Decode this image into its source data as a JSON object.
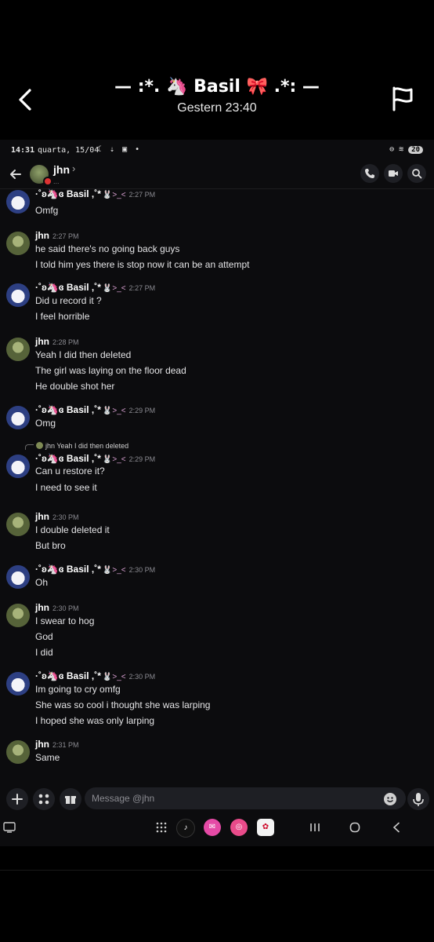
{
  "viewer": {
    "title": "— :*. 🦄 Basil 🎀 .*: —",
    "subtitle": "Gestern 23:40"
  },
  "status_bar": {
    "time": "14:31",
    "date": "quarta, 15/04",
    "battery": "20"
  },
  "chat_header": {
    "name": "jhn",
    "chevron": "›",
    "subtitle": "..."
  },
  "name_deco": "🐰>_<",
  "messages": [
    {
      "author": "·˚ʚ🦄ɞ Basil ,˚*",
      "time": "2:27 PM",
      "lines": [
        "Omfg"
      ]
    },
    {
      "author": "jhn",
      "time": "2:27 PM",
      "lines": [
        "he said there's no going back guys",
        "I told him yes there is stop now it can be an attempt"
      ]
    },
    {
      "author": "·˚ʚ🦄ɞ Basil ,˚*",
      "time": "2:27 PM",
      "lines": [
        "Did u record it ?",
        "I feel horrible"
      ]
    },
    {
      "author": "jhn",
      "time": "2:28 PM",
      "lines": [
        "Yeah I did then deleted",
        "The girl was laying on the floor dead",
        "He double shot her"
      ]
    },
    {
      "author": "·˚ʚ🦄ɞ Basil ,˚*",
      "time": "2:29 PM",
      "lines": [
        "Omg"
      ]
    },
    {
      "author": "·˚ʚ🦄ɞ Basil ,˚*",
      "time": "2:29 PM",
      "reply": {
        "name": "jhn",
        "text": "Yeah I did then deleted"
      },
      "lines": [
        "Can u restore it?",
        "I need to see it"
      ]
    },
    {
      "author": "jhn",
      "time": "2:30 PM",
      "lines": [
        "I double deleted it",
        "But bro"
      ]
    },
    {
      "author": "·˚ʚ🦄ɞ Basil ,˚*",
      "time": "2:30 PM",
      "lines": [
        "Oh"
      ]
    },
    {
      "author": "jhn",
      "time": "2:30 PM",
      "lines": [
        "I swear to hog",
        "God",
        "I did"
      ]
    },
    {
      "author": "·˚ʚ🦄ɞ Basil ,˚*",
      "time": "2:30 PM",
      "lines": [
        "Im going to cry omfg",
        "She was so cool i thought she was larping",
        "I hoped she was only larping"
      ]
    },
    {
      "author": "jhn",
      "time": "2:31 PM",
      "lines": [
        "Same"
      ]
    }
  ],
  "composer": {
    "placeholder": "Message @jhn"
  },
  "dock_apps": [
    "tiktok-icon",
    "mail-icon",
    "chrome-icon",
    "photo-app-icon"
  ],
  "colors": {
    "background": "#000000",
    "chat_background": "#0c0c0e",
    "input_background": "#1e1f24",
    "timestamp": "#8a8a90"
  }
}
